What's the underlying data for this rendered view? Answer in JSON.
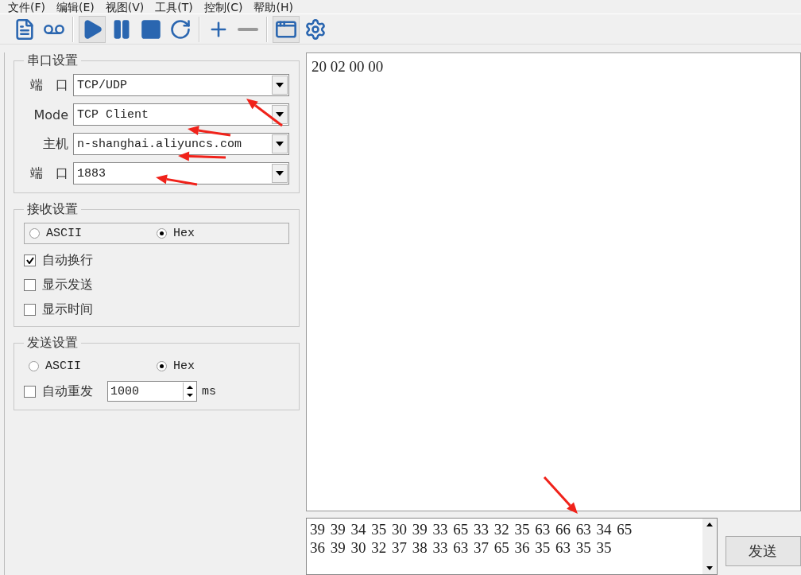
{
  "menu": [
    "文件(F)",
    "编辑(E)",
    "视图(V)",
    "工具(T)",
    "控制(C)",
    "帮助(H)"
  ],
  "toolbar": [
    {
      "kind": "document",
      "pressed": false
    },
    {
      "kind": "tape",
      "pressed": false
    },
    {
      "kind": "separator"
    },
    {
      "kind": "play",
      "pressed": true
    },
    {
      "kind": "pause",
      "pressed": false
    },
    {
      "kind": "stop",
      "pressed": false
    },
    {
      "kind": "refresh",
      "pressed": false
    },
    {
      "kind": "separator"
    },
    {
      "kind": "plus",
      "pressed": false
    },
    {
      "kind": "minus",
      "pressed": false
    },
    {
      "kind": "separator"
    },
    {
      "kind": "window",
      "pressed": true
    },
    {
      "kind": "gear",
      "pressed": false
    }
  ],
  "serial_settings": {
    "title": "串口设置",
    "fields": [
      {
        "label": "端　口",
        "value": "TCP/UDP"
      },
      {
        "label": "Mode",
        "value": "TCP Client"
      },
      {
        "label": "主机",
        "value": "n-shanghai.aliyuncs.com"
      },
      {
        "label": "端　口",
        "value": "1883"
      }
    ]
  },
  "receive_settings": {
    "title": "接收设置",
    "format": [
      {
        "label": "ASCII",
        "selected": false
      },
      {
        "label": "Hex",
        "selected": true
      }
    ],
    "options": [
      {
        "label": "自动换行",
        "checked": true
      },
      {
        "label": "显示发送",
        "checked": false
      },
      {
        "label": "显示时间",
        "checked": false
      }
    ]
  },
  "send_settings": {
    "title": "发送设置",
    "format": [
      {
        "label": "ASCII",
        "selected": false
      },
      {
        "label": "Hex",
        "selected": true
      }
    ],
    "auto_resend": {
      "label": "自动重发",
      "checked": false,
      "value": "1000",
      "unit": "ms"
    }
  },
  "receive_area": {
    "lines": [
      "20 02 00 00"
    ]
  },
  "send_area": {
    "lines": [
      "39 39 34 35 30 39 33 65 33 32 35 63 66 63 34 65",
      "36 39 30 32 37 38 33 63 37 65 36 35 63 35 35"
    ]
  },
  "send_button": "发送"
}
